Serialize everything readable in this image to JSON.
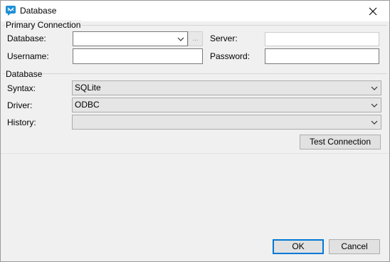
{
  "window": {
    "title": "Database",
    "close_glyph": "✕"
  },
  "primary": {
    "legend": "Primary Connection",
    "database_label": "Database:",
    "database_value": "",
    "browse_label": "...",
    "server_label": "Server:",
    "server_value": "",
    "username_label": "Username:",
    "username_value": "",
    "password_label": "Password:",
    "password_value": ""
  },
  "database": {
    "legend": "Database",
    "syntax_label": "Syntax:",
    "syntax_value": "SQLite",
    "driver_label": "Driver:",
    "driver_value": "ODBC",
    "history_label": "History:",
    "history_value": "",
    "test_button": "Test Connection"
  },
  "footer": {
    "ok_label": "OK",
    "cancel_label": "Cancel"
  },
  "colors": {
    "accent": "#0078d7",
    "app_icon": "#1e90d6"
  }
}
